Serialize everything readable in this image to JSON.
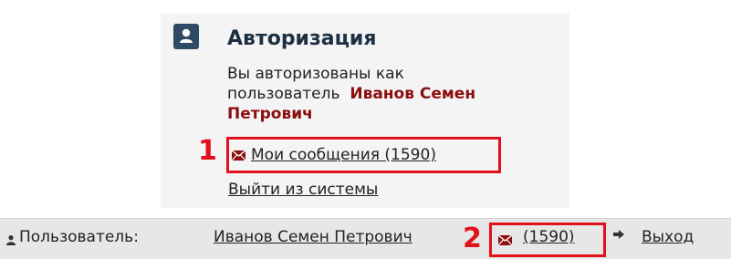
{
  "auth_block": {
    "title": "Авторизация",
    "intro_line1": "Вы авторизованы как",
    "intro_line2": "пользователь",
    "user_name": "Иванов Семен Петрович",
    "messages_link": "Мои сообщения (1590)",
    "logout_link": "Выйти из системы",
    "icon": "user-icon"
  },
  "bottom_bar": {
    "user_label": "Пользователь:",
    "user_name": "Иванов Семен Петрович",
    "messages_count": "(1590)",
    "logout_label": "Выход",
    "icons": [
      "user-icon",
      "envelope-icon",
      "arrow-right-icon"
    ]
  },
  "annotations": {
    "marker_1": "1",
    "marker_2": "2"
  },
  "colors": {
    "highlight": "#e3111b",
    "user_name": "#8b0d0d",
    "title": "#1d2f44",
    "icon_bg": "#2f4a66"
  }
}
